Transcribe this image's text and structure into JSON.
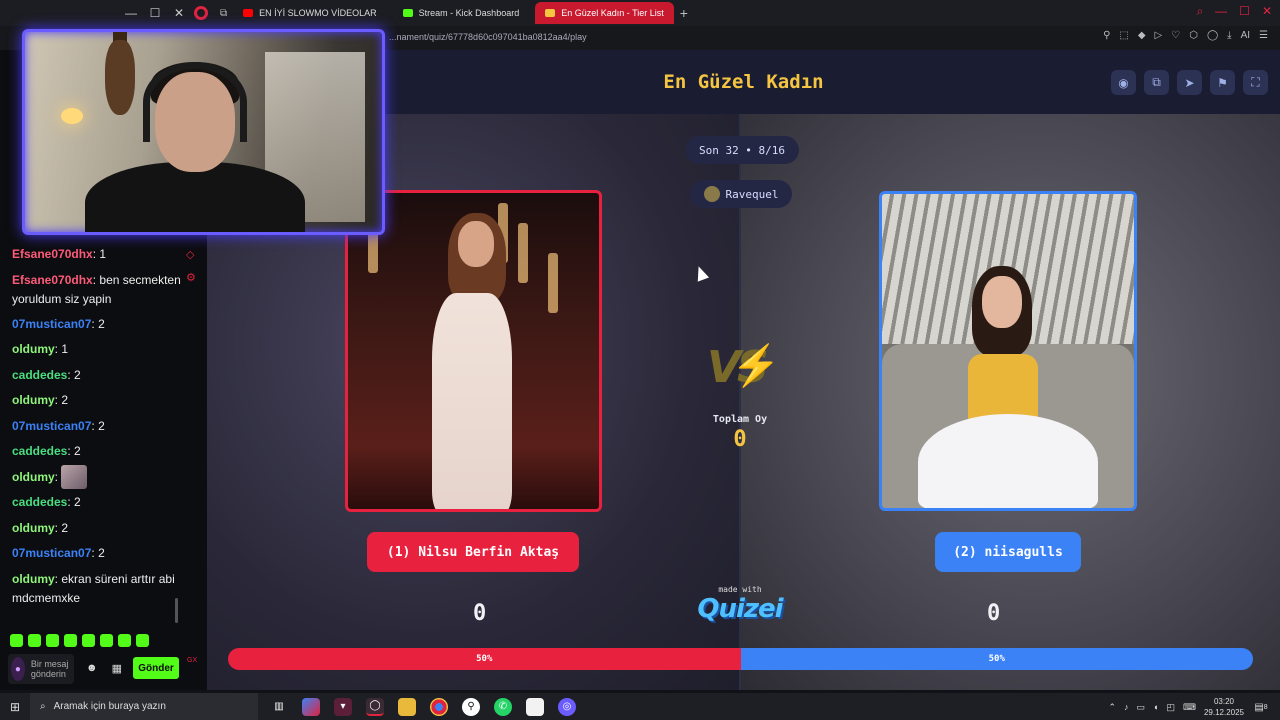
{
  "browser": {
    "tabs": [
      {
        "label": "EN İYİ SLOWMO VİDEOLAR",
        "favicon_color": "#ff0000",
        "active": false
      },
      {
        "label": "Stream - Kick Dashboard",
        "favicon_color": "#53fc18",
        "active": false
      },
      {
        "label": "En Güzel Kadın - Tier List",
        "favicon_color": "#f5c542",
        "active": true
      }
    ],
    "url": "...nament/quiz/67778d60c097041ba0812aa4/play",
    "new_tab_icon": "+",
    "toolbar_right_label": "AI"
  },
  "chat": {
    "messages": [
      {
        "user": "Efsane070dhx",
        "text": "1",
        "color": "#ff5a7a"
      },
      {
        "user": "Efsane070dhx",
        "text": "ben secmekten yoruldum siz yapin",
        "color": "#ff5a7a"
      },
      {
        "user": "07mustican07",
        "text": "2",
        "color": "#3b82f6"
      },
      {
        "user": "oldumy",
        "text": "1",
        "color": "#8ef57a"
      },
      {
        "user": "caddedes",
        "text": "2",
        "color": "#4ade80"
      },
      {
        "user": "oldumy",
        "text": "2",
        "color": "#8ef57a"
      },
      {
        "user": "07mustican07",
        "text": "2",
        "color": "#3b82f6"
      },
      {
        "user": "caddedes",
        "text": "2",
        "color": "#4ade80"
      },
      {
        "user": "oldumy",
        "text": "",
        "color": "#8ef57a"
      },
      {
        "user": "caddedes",
        "text": "2",
        "color": "#4ade80"
      },
      {
        "user": "oldumy",
        "text": "2",
        "color": "#8ef57a"
      },
      {
        "user": "07mustican07",
        "text": "2",
        "color": "#3b82f6"
      },
      {
        "user": "oldumy",
        "text": "ekran süreni arttır abi mdcmemxke",
        "color": "#8ef57a"
      }
    ],
    "input_placeholder": "Bir mesaj gönderin",
    "send_label": "Gönder",
    "gx_label": "GX"
  },
  "quiz": {
    "title": "En Güzel Kadın",
    "round": "Son 32 • 8/16",
    "creator": "Ravequel",
    "header_icons": [
      "eye-icon",
      "share-icon",
      "send-icon",
      "flag-icon",
      "fullscreen-icon"
    ],
    "left": {
      "name": "(1) Nilsu Berfin Aktaş",
      "votes": "0",
      "percent": 50,
      "percent_label": "50%",
      "color": "#e8213f"
    },
    "right": {
      "name": "(2) niisagulls",
      "votes": "0",
      "percent": 50,
      "percent_label": "50%",
      "color": "#3b82f6"
    },
    "total_label": "Toplam Oy",
    "total_value": "0",
    "made_with": "made with",
    "brand": "Quizei"
  },
  "taskbar": {
    "search_placeholder": "Aramak için buraya yazın",
    "time": "03:20",
    "date": "29.12.2025",
    "notification_count": "8"
  }
}
